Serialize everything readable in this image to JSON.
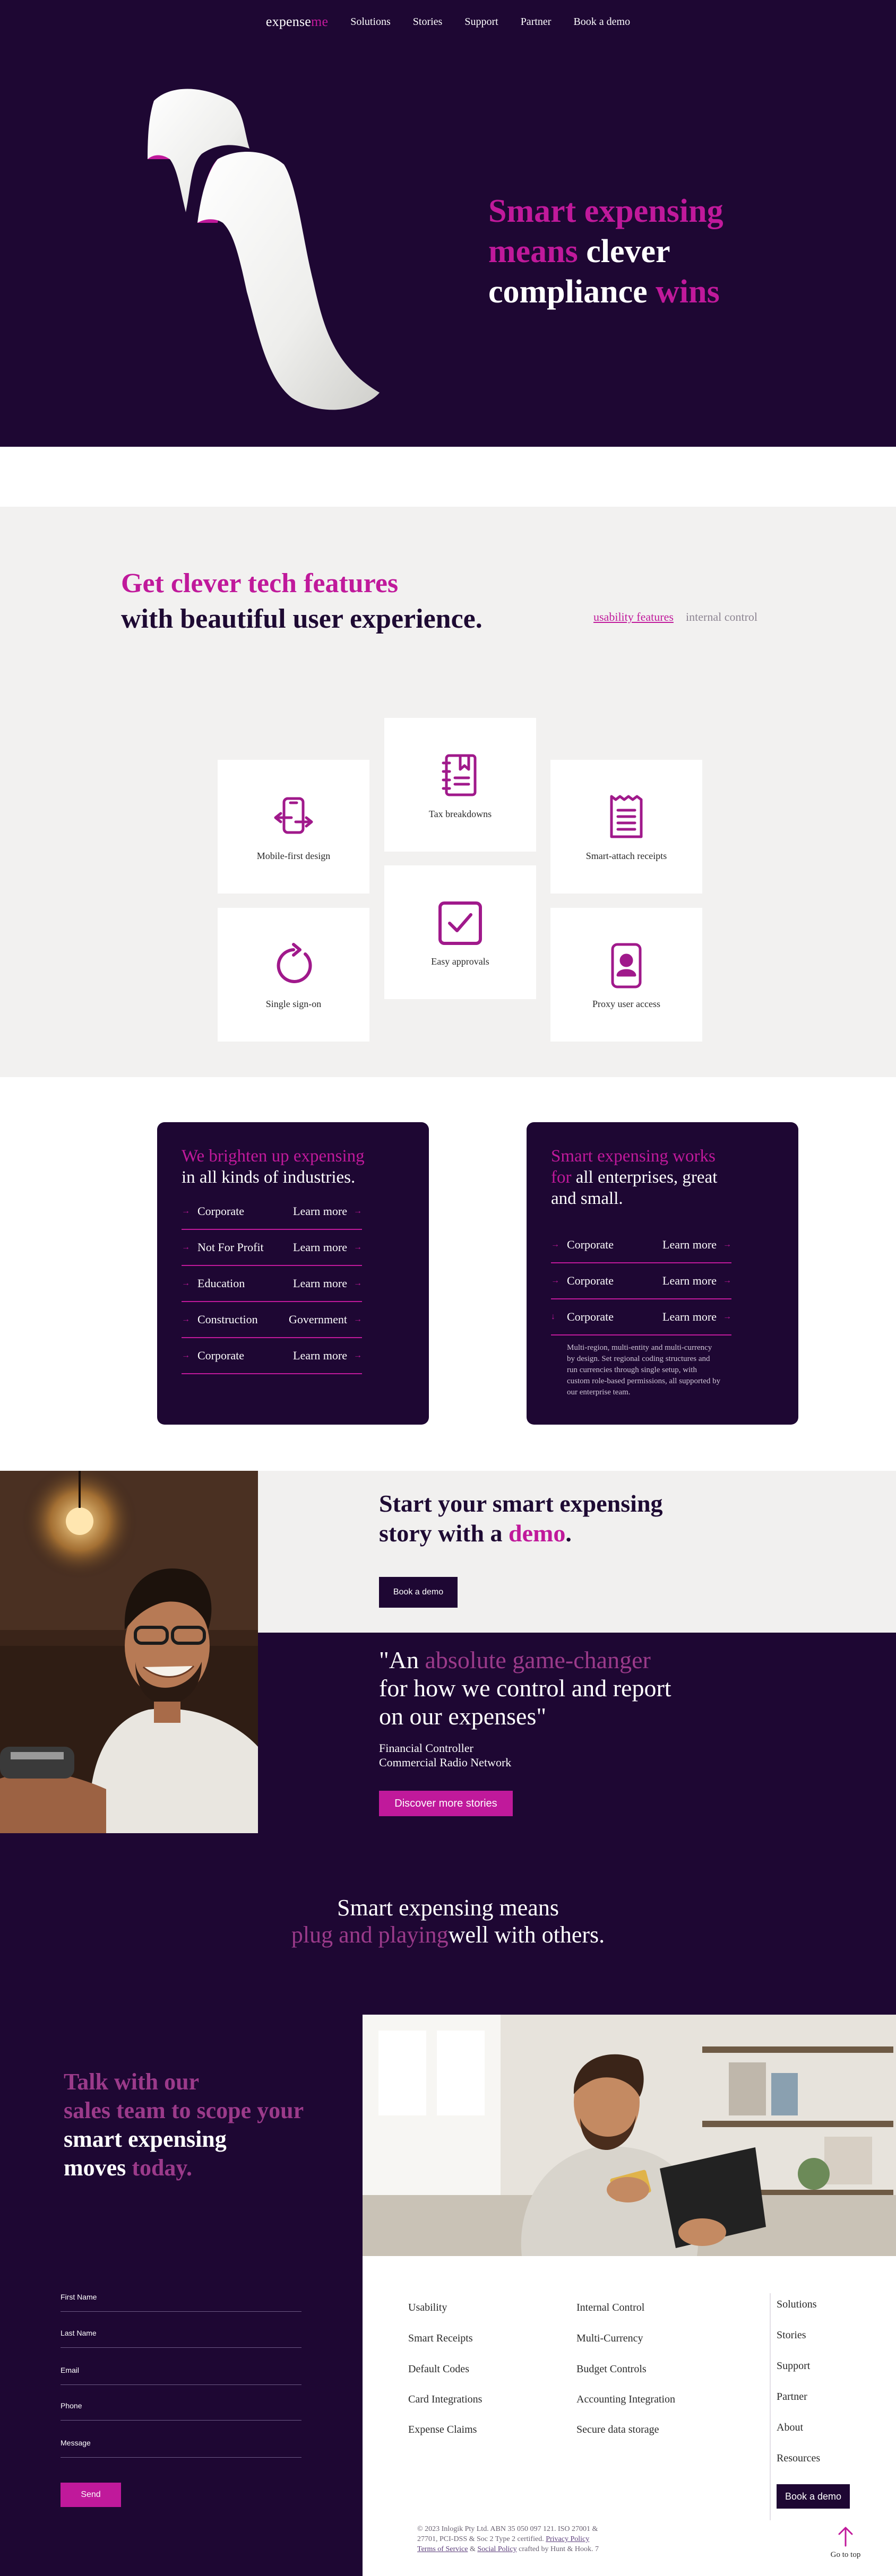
{
  "nav": {
    "logo_main": "expense",
    "logo_accent": "me",
    "links": [
      "Solutions",
      "Stories",
      "Support",
      "Partner",
      "Book a demo"
    ]
  },
  "hero": {
    "line1": "Smart expensing",
    "line2_a": "means",
    "line2_b": " clever",
    "line3_a": "compliance",
    "line3_b": " wins"
  },
  "features": {
    "heading_1": "Get clever tech features",
    "heading_2": "with beautiful user experience.",
    "tab_active": "usability features",
    "tab_inactive": "internal control",
    "cards": [
      {
        "label": "Mobile-first design",
        "icon": "mobile-icon"
      },
      {
        "label": "Tax breakdowns",
        "icon": "notebook-icon"
      },
      {
        "label": "Smart-attach receipts",
        "icon": "receipt-icon"
      },
      {
        "label": "Single sign-on",
        "icon": "refresh-icon"
      },
      {
        "label": "Easy approvals",
        "icon": "checkbox-icon"
      },
      {
        "label": "Proxy user access",
        "icon": "user-phone-icon"
      }
    ]
  },
  "industries": {
    "left": {
      "title_a": "We brighten up expensing",
      "title_b": "in all kinds of industries.",
      "rows": [
        {
          "name": "Corporate",
          "cta": "Learn more"
        },
        {
          "name": "Not For Profit",
          "cta": "Learn more"
        },
        {
          "name": "Education",
          "cta": "Learn more"
        },
        {
          "name": "Construction",
          "cta": "Government"
        },
        {
          "name": "Corporate",
          "cta": "Learn more"
        }
      ]
    },
    "right": {
      "title_a": "Smart expensing works",
      "title_b": "for",
      "title_c": " all enterprises, great",
      "title_d": "and small.",
      "rows": [
        {
          "name": "Corporate",
          "cta": "Learn more"
        },
        {
          "name": "Corporate",
          "cta": "Learn more"
        },
        {
          "name": "Corporate",
          "cta": "Learn more"
        }
      ],
      "description": "Multi-region, multi-entity and multi-currency by design. Set regional coding structures and run currencies through single setup, with custom role-based permissions, all supported by our enterprise team."
    }
  },
  "story": {
    "heading_a": "Start your smart expensing",
    "heading_b": "story with a ",
    "heading_c": "demo",
    "heading_d": ".",
    "button": "Book a demo"
  },
  "quote": {
    "open": "\"An ",
    "accent": "absolute game-changer",
    "line2": "for how we control and report",
    "line3": "on our expenses\"",
    "role": "Financial Controller",
    "company": "Commercial Radio Network",
    "button": "Discover more stories"
  },
  "plug": {
    "line1": "Smart expensing means",
    "line2_a": "plug and playing",
    "line2_b": "well with others."
  },
  "contact": {
    "line1": "Talk with our",
    "line2": "sales team to scope your",
    "line3": "smart expensing",
    "line4_a": "moves ",
    "line4_b": "today.",
    "fields": [
      "First Name",
      "Last Name",
      "Email",
      "Phone",
      "Message"
    ],
    "send": "Send"
  },
  "footer": {
    "col1": [
      "Usability",
      "Smart Receipts",
      "Default Codes",
      "Card Integrations",
      "Expense Claims"
    ],
    "col2": [
      "Internal Control",
      "Multi-Currency",
      "Budget Controls",
      "Accounting Integration",
      "Secure data storage"
    ],
    "col3": [
      "Solutions",
      "Stories",
      "Support",
      "Partner",
      "About",
      "Resources"
    ],
    "demo_button": "Book a demo",
    "legal_1": "© 2023 Inlogik Pty Ltd. ABN 35 050 097 121. ISO 27001 &",
    "legal_2": "27701, PCI-DSS & Soc 2 Type 2 certified. ",
    "privacy": "Privacy Policy",
    "legal_3a": "",
    "terms": "Terms of Service",
    "legal_3b": " & ",
    "social": "Social Policy",
    "legal_3c": " crafted by Hunt & Hook. 7",
    "go_top": "Go to top"
  },
  "colors": {
    "dark_purple": "#1e0733",
    "magenta": "#c0199b",
    "light_grey": "#f2f1f0"
  }
}
